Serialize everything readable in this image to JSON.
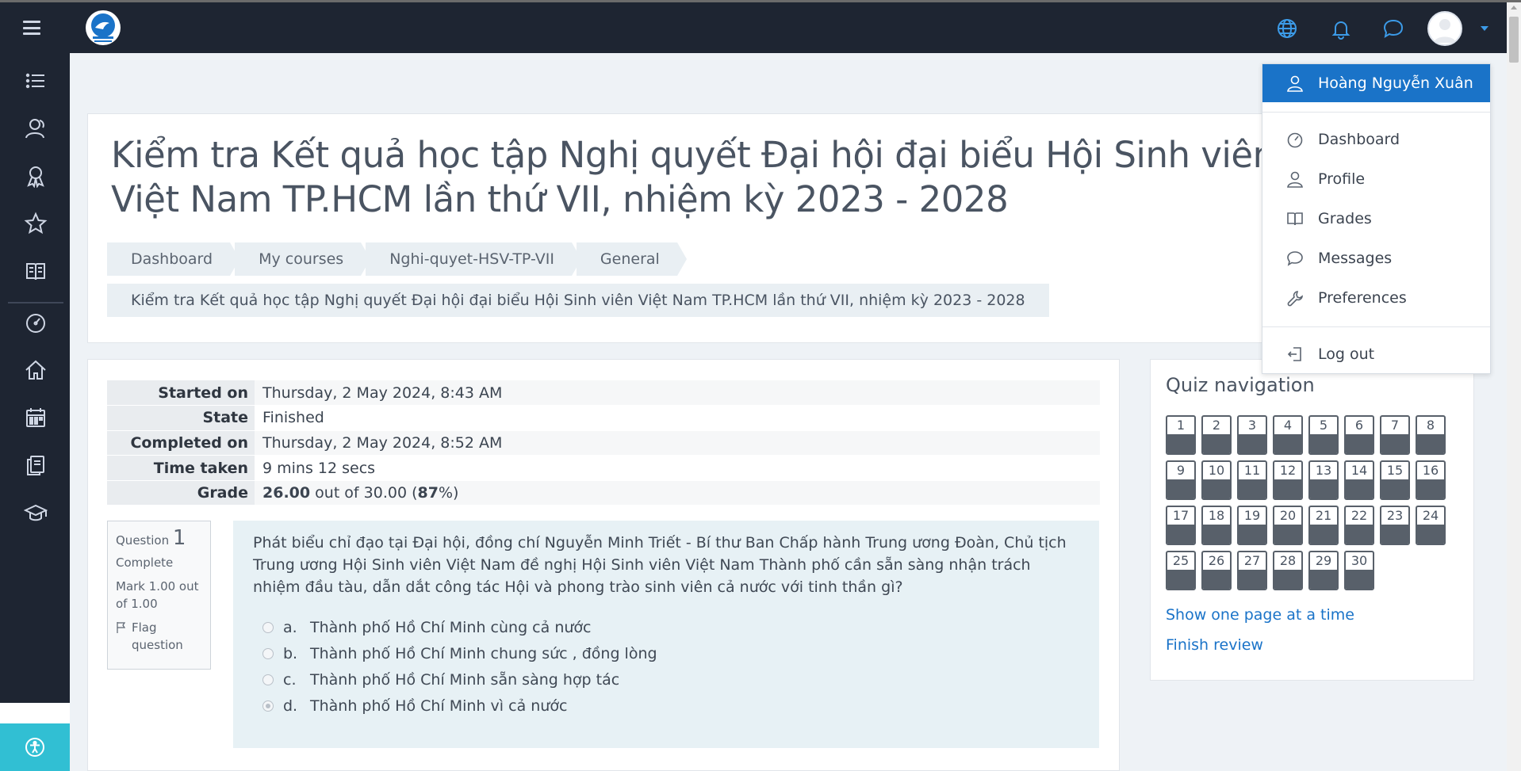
{
  "user": {
    "name": "Hoàng Nguyễn Xuân"
  },
  "user_menu": [
    {
      "label": "Dashboard",
      "icon": "speedometer-icon"
    },
    {
      "label": "Profile",
      "icon": "user-icon"
    },
    {
      "label": "Grades",
      "icon": "grades-book-icon"
    },
    {
      "label": "Messages",
      "icon": "speech-bubble-icon"
    },
    {
      "label": "Preferences",
      "icon": "wrench-icon"
    },
    {
      "label": "Log out",
      "icon": "logout-icon"
    }
  ],
  "page_title": "Kiểm tra Kết quả học tập Nghị quyết Đại hội đại biểu Hội Sinh viên Việt Nam TP.HCM lần thứ VII, nhiệm kỳ 2023 - 2028",
  "breadcrumb": [
    "Dashboard",
    "My courses",
    "Nghi-quyet-HSV-TP-VII",
    "General"
  ],
  "breadcrumb_current": "Kiểm tra Kết quả học tập Nghị quyết Đại hội đại biểu Hội Sinh viên Việt Nam TP.HCM lần thứ VII, nhiệm kỳ 2023 - 2028",
  "summary": {
    "started_label": "Started on",
    "started_value": "Thursday, 2 May 2024, 8:43 AM",
    "state_label": "State",
    "state_value": "Finished",
    "completed_label": "Completed on",
    "completed_value": "Thursday, 2 May 2024, 8:52 AM",
    "time_label": "Time taken",
    "time_value": "9 mins 12 secs",
    "grade_label": "Grade",
    "grade_score": "26.00",
    "grade_rest": " out of 30.00 (",
    "grade_percent": "87",
    "grade_close": "%)"
  },
  "question": {
    "label": "Question",
    "number": "1",
    "status": "Complete",
    "mark": "Mark 1.00 out of 1.00",
    "flag": "Flag question",
    "text": "Phát biểu chỉ đạo tại Đại hội, đồng chí Nguyễn Minh Triết - Bí thư Ban Chấp hành Trung ương Đoàn, Chủ tịch Trung ương Hội Sinh viên Việt Nam đề nghị Hội Sinh viên Việt Nam Thành phố cần sẵn sàng nhận trách nhiệm đầu tàu, dẫn dắt công tác Hội và phong trào sinh viên cả nước với tinh thần gì?",
    "answers": [
      {
        "letter": "a.",
        "text": "Thành phố Hồ Chí Minh cùng cả nước",
        "checked": false
      },
      {
        "letter": "b.",
        "text": "Thành phố Hồ Chí Minh chung sức , đồng lòng",
        "checked": false
      },
      {
        "letter": "c.",
        "text": "Thành phố Hồ Chí Minh sẵn sàng hợp tác",
        "checked": false
      },
      {
        "letter": "d.",
        "text": "Thành phố Hồ Chí Minh vì cả nước",
        "checked": true
      }
    ]
  },
  "quiz_nav": {
    "title": "Quiz navigation",
    "questions": [
      "1",
      "2",
      "3",
      "4",
      "5",
      "6",
      "7",
      "8",
      "9",
      "10",
      "11",
      "12",
      "13",
      "14",
      "15",
      "16",
      "17",
      "18",
      "19",
      "20",
      "21",
      "22",
      "23",
      "24",
      "25",
      "26",
      "27",
      "28",
      "29",
      "30"
    ],
    "show_one_page": "Show one page at a time",
    "finish_review": "Finish review"
  },
  "colors": {
    "navbar": "#1e2532",
    "accent": "#1a73c8",
    "accessibility": "#31bfd3"
  }
}
